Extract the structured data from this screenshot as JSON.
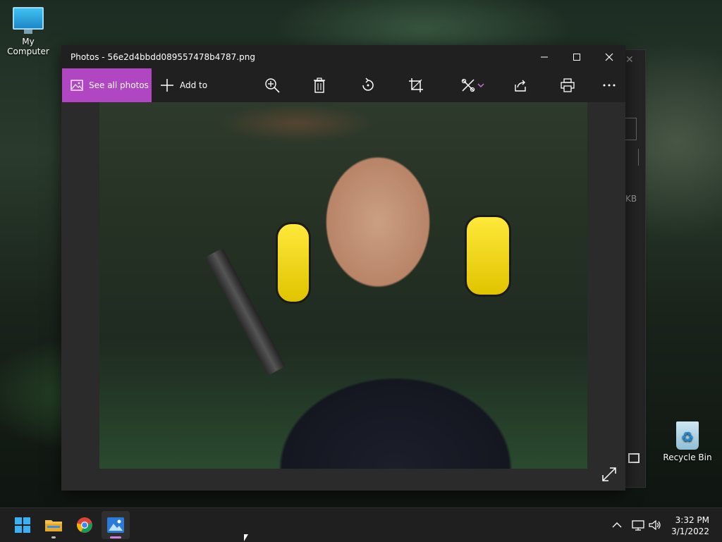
{
  "desktop": {
    "icons": [
      {
        "label": "My Computer",
        "icon": "computer-icon"
      },
      {
        "label": "Recycle Bin",
        "icon": "recycle-bin-icon"
      }
    ],
    "background_window_fragment": {
      "text": "KB"
    }
  },
  "window": {
    "title": "Photos - 56e2d4bbdd089557478b4787.png",
    "controls": {
      "minimize": "–",
      "maximize": "□",
      "close": "✕"
    }
  },
  "toolbar": {
    "see_all_label": "See all photos",
    "add_to_label": "Add to",
    "accent_color": "#b146c2",
    "icons": [
      "zoom-in-icon",
      "delete-icon",
      "rotate-icon",
      "crop-icon",
      "edit-icon",
      "share-icon",
      "print-icon",
      "more-icon"
    ]
  },
  "photo": {
    "description_icon": "photo-content",
    "expand_icon": "expand-icon"
  },
  "taskbar": {
    "apps": [
      {
        "name": "start-button",
        "icon": "windows-icon"
      },
      {
        "name": "file-explorer",
        "icon": "folder-icon"
      },
      {
        "name": "chrome",
        "icon": "chrome-icon"
      },
      {
        "name": "photos",
        "icon": "photos-icon",
        "active": true
      }
    ],
    "clock": {
      "time": "3:32 PM",
      "date": "3/1/2022"
    }
  }
}
